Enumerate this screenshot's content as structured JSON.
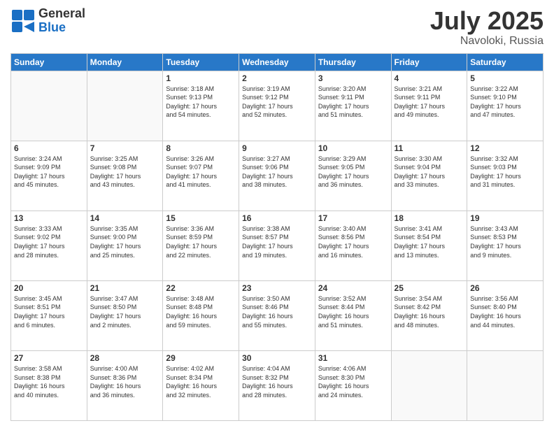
{
  "header": {
    "logo_general": "General",
    "logo_blue": "Blue",
    "title": "July 2025",
    "location": "Navoloki, Russia"
  },
  "days_of_week": [
    "Sunday",
    "Monday",
    "Tuesday",
    "Wednesday",
    "Thursday",
    "Friday",
    "Saturday"
  ],
  "weeks": [
    [
      {
        "day": "",
        "info": ""
      },
      {
        "day": "",
        "info": ""
      },
      {
        "day": "1",
        "info": "Sunrise: 3:18 AM\nSunset: 9:13 PM\nDaylight: 17 hours\nand 54 minutes."
      },
      {
        "day": "2",
        "info": "Sunrise: 3:19 AM\nSunset: 9:12 PM\nDaylight: 17 hours\nand 52 minutes."
      },
      {
        "day": "3",
        "info": "Sunrise: 3:20 AM\nSunset: 9:11 PM\nDaylight: 17 hours\nand 51 minutes."
      },
      {
        "day": "4",
        "info": "Sunrise: 3:21 AM\nSunset: 9:11 PM\nDaylight: 17 hours\nand 49 minutes."
      },
      {
        "day": "5",
        "info": "Sunrise: 3:22 AM\nSunset: 9:10 PM\nDaylight: 17 hours\nand 47 minutes."
      }
    ],
    [
      {
        "day": "6",
        "info": "Sunrise: 3:24 AM\nSunset: 9:09 PM\nDaylight: 17 hours\nand 45 minutes."
      },
      {
        "day": "7",
        "info": "Sunrise: 3:25 AM\nSunset: 9:08 PM\nDaylight: 17 hours\nand 43 minutes."
      },
      {
        "day": "8",
        "info": "Sunrise: 3:26 AM\nSunset: 9:07 PM\nDaylight: 17 hours\nand 41 minutes."
      },
      {
        "day": "9",
        "info": "Sunrise: 3:27 AM\nSunset: 9:06 PM\nDaylight: 17 hours\nand 38 minutes."
      },
      {
        "day": "10",
        "info": "Sunrise: 3:29 AM\nSunset: 9:05 PM\nDaylight: 17 hours\nand 36 minutes."
      },
      {
        "day": "11",
        "info": "Sunrise: 3:30 AM\nSunset: 9:04 PM\nDaylight: 17 hours\nand 33 minutes."
      },
      {
        "day": "12",
        "info": "Sunrise: 3:32 AM\nSunset: 9:03 PM\nDaylight: 17 hours\nand 31 minutes."
      }
    ],
    [
      {
        "day": "13",
        "info": "Sunrise: 3:33 AM\nSunset: 9:02 PM\nDaylight: 17 hours\nand 28 minutes."
      },
      {
        "day": "14",
        "info": "Sunrise: 3:35 AM\nSunset: 9:00 PM\nDaylight: 17 hours\nand 25 minutes."
      },
      {
        "day": "15",
        "info": "Sunrise: 3:36 AM\nSunset: 8:59 PM\nDaylight: 17 hours\nand 22 minutes."
      },
      {
        "day": "16",
        "info": "Sunrise: 3:38 AM\nSunset: 8:57 PM\nDaylight: 17 hours\nand 19 minutes."
      },
      {
        "day": "17",
        "info": "Sunrise: 3:40 AM\nSunset: 8:56 PM\nDaylight: 17 hours\nand 16 minutes."
      },
      {
        "day": "18",
        "info": "Sunrise: 3:41 AM\nSunset: 8:54 PM\nDaylight: 17 hours\nand 13 minutes."
      },
      {
        "day": "19",
        "info": "Sunrise: 3:43 AM\nSunset: 8:53 PM\nDaylight: 17 hours\nand 9 minutes."
      }
    ],
    [
      {
        "day": "20",
        "info": "Sunrise: 3:45 AM\nSunset: 8:51 PM\nDaylight: 17 hours\nand 6 minutes."
      },
      {
        "day": "21",
        "info": "Sunrise: 3:47 AM\nSunset: 8:50 PM\nDaylight: 17 hours\nand 2 minutes."
      },
      {
        "day": "22",
        "info": "Sunrise: 3:48 AM\nSunset: 8:48 PM\nDaylight: 16 hours\nand 59 minutes."
      },
      {
        "day": "23",
        "info": "Sunrise: 3:50 AM\nSunset: 8:46 PM\nDaylight: 16 hours\nand 55 minutes."
      },
      {
        "day": "24",
        "info": "Sunrise: 3:52 AM\nSunset: 8:44 PM\nDaylight: 16 hours\nand 51 minutes."
      },
      {
        "day": "25",
        "info": "Sunrise: 3:54 AM\nSunset: 8:42 PM\nDaylight: 16 hours\nand 48 minutes."
      },
      {
        "day": "26",
        "info": "Sunrise: 3:56 AM\nSunset: 8:40 PM\nDaylight: 16 hours\nand 44 minutes."
      }
    ],
    [
      {
        "day": "27",
        "info": "Sunrise: 3:58 AM\nSunset: 8:38 PM\nDaylight: 16 hours\nand 40 minutes."
      },
      {
        "day": "28",
        "info": "Sunrise: 4:00 AM\nSunset: 8:36 PM\nDaylight: 16 hours\nand 36 minutes."
      },
      {
        "day": "29",
        "info": "Sunrise: 4:02 AM\nSunset: 8:34 PM\nDaylight: 16 hours\nand 32 minutes."
      },
      {
        "day": "30",
        "info": "Sunrise: 4:04 AM\nSunset: 8:32 PM\nDaylight: 16 hours\nand 28 minutes."
      },
      {
        "day": "31",
        "info": "Sunrise: 4:06 AM\nSunset: 8:30 PM\nDaylight: 16 hours\nand 24 minutes."
      },
      {
        "day": "",
        "info": ""
      },
      {
        "day": "",
        "info": ""
      }
    ]
  ]
}
